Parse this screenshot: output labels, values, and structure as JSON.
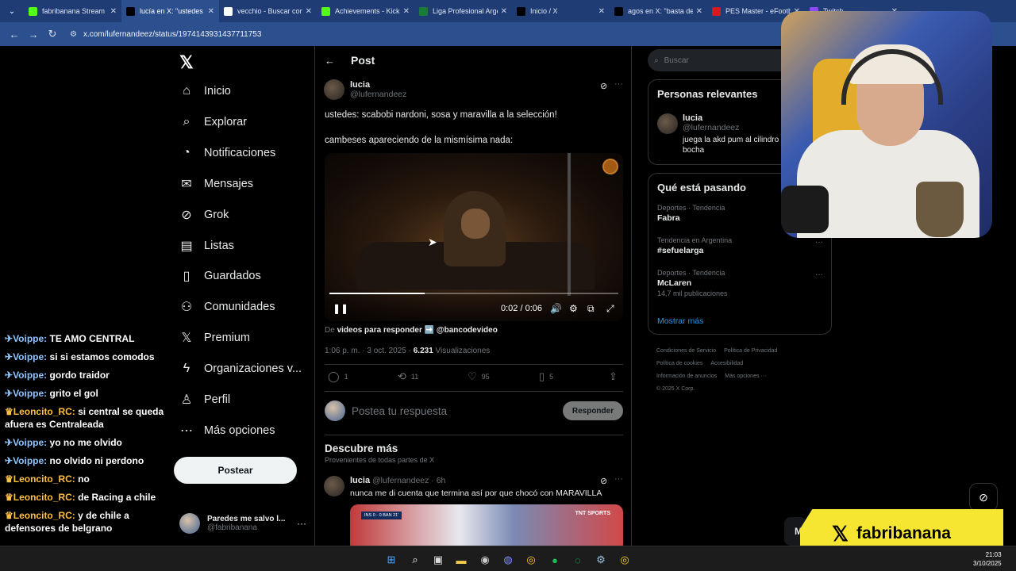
{
  "browser": {
    "tabs": [
      {
        "icon": "kick-favicon",
        "color": "#53fc18",
        "title": "fabribanana Stream",
        "active": false
      },
      {
        "icon": "x-favicon",
        "color": "#000000",
        "title": "lucía en X: \"ustedes",
        "active": true
      },
      {
        "icon": "google-favicon",
        "color": "#ffffff",
        "title": "vecchio - Buscar con",
        "active": false
      },
      {
        "icon": "kick-favicon",
        "color": "#53fc18",
        "title": "Achievements - Kick",
        "active": false
      },
      {
        "icon": "lpf-favicon",
        "color": "#1a7a3a",
        "title": "Liga Profesional Arge",
        "active": false
      },
      {
        "icon": "x-favicon",
        "color": "#000000",
        "title": "Inicio / X",
        "active": false
      },
      {
        "icon": "x-favicon",
        "color": "#000000",
        "title": "agos en X: \"basta de",
        "active": false
      },
      {
        "icon": "pes-favicon",
        "color": "#d41b24",
        "title": "PES Master - eFootba",
        "active": false
      },
      {
        "icon": "twitch-favicon",
        "color": "#9146ff",
        "title": "Twitch",
        "active": false
      }
    ],
    "url": "x.com/lufernandeez/status/1974143931437711753"
  },
  "nav": {
    "items": [
      {
        "icon": "home-icon",
        "glyph": "⌂",
        "label": "Inicio"
      },
      {
        "icon": "explore-icon",
        "glyph": "⌕",
        "label": "Explorar"
      },
      {
        "icon": "bell-icon",
        "glyph": "◔",
        "label": "Notificaciones"
      },
      {
        "icon": "mail-icon",
        "glyph": "✉",
        "label": "Mensajes"
      },
      {
        "icon": "grok-icon",
        "glyph": "⊘",
        "label": "Grok"
      },
      {
        "icon": "list-icon",
        "glyph": "▤",
        "label": "Listas"
      },
      {
        "icon": "bookmark-icon",
        "glyph": "▯",
        "label": "Guardados"
      },
      {
        "icon": "communities-icon",
        "glyph": "⚇",
        "label": "Comunidades"
      },
      {
        "icon": "x-premium-icon",
        "glyph": "𝕏",
        "label": "Premium"
      },
      {
        "icon": "bolt-icon",
        "glyph": "ϟ",
        "label": "Organizaciones v..."
      },
      {
        "icon": "person-icon",
        "glyph": "♙",
        "label": "Perfil"
      },
      {
        "icon": "more-circle-icon",
        "glyph": "⋯",
        "label": "Más opciones"
      }
    ],
    "post_button": "Postear",
    "account": {
      "name": "Paredes me salvo l...",
      "handle": "@fabribanana"
    }
  },
  "chat": [
    {
      "badge": "✈",
      "user": "Voippe:",
      "msg": "TE AMO CENTRAL",
      "vip": false
    },
    {
      "badge": "✈",
      "user": "Voippe:",
      "msg": "si si estamos comodos",
      "vip": false
    },
    {
      "badge": "✈",
      "user": "Voippe:",
      "msg": "gordo traidor",
      "vip": false
    },
    {
      "badge": "✈",
      "user": "Voippe:",
      "msg": "grito el gol",
      "vip": false
    },
    {
      "badge": "♛",
      "user": "Leoncito_RC:",
      "msg": "si central se queda afuera es Centraleada",
      "vip": true
    },
    {
      "badge": "✈",
      "user": "Voippe:",
      "msg": "yo no me olvido",
      "vip": false
    },
    {
      "badge": "✈",
      "user": "Voippe:",
      "msg": "no olvido ni perdono",
      "vip": false
    },
    {
      "badge": "♛",
      "user": "Leoncito_RC:",
      "msg": "no",
      "vip": true
    },
    {
      "badge": "♛",
      "user": "Leoncito_RC:",
      "msg": "de Racing a chile",
      "vip": true
    },
    {
      "badge": "♛",
      "user": "Leoncito_RC:",
      "msg": "y de chile a defensores de belgrano",
      "vip": true
    }
  ],
  "post": {
    "header": "Post",
    "author_name": "lucia",
    "author_handle": "@lufernandeez",
    "text1": "ustedes: scabobi nardoni, sosa y maravilla a la selección!",
    "text2": "cambeses apareciendo de la mismísima nada:",
    "video": {
      "time": "0:02 / 0:06",
      "progress": 0.33
    },
    "source_prefix": "De",
    "source_link": "videos para responder ➡️ @bancodevideo",
    "timestamp": "1:06 p. m. · 3 oct. 2025 ·",
    "views": "6.231",
    "views_label": "Visualizaciones",
    "stats": {
      "replies": "1",
      "reposts": "11",
      "likes": "95",
      "bookmarks": "5"
    },
    "reply_placeholder": "Postea tu respuesta",
    "reply_button": "Responder"
  },
  "discover": {
    "title": "Descubre más",
    "subtitle": "Provenientes de todas partes de X",
    "post": {
      "name": "lucia",
      "handle": "@lufernandeez · 6h",
      "text": "nunca me di cuenta que termina así por que chocó con MARAVILLA",
      "score": "INS 0 - 0 BAN 21'",
      "brand": "TNT SPORTS"
    }
  },
  "sidebar": {
    "search_placeholder": "Buscar",
    "relevant": {
      "title": "Personas relevantes",
      "name": "lucia",
      "handle": "@lufernandeez",
      "bio": "juega la akd pum al cilindro bocha"
    },
    "trends": {
      "title": "Qué está pasando",
      "items": [
        {
          "context": "Deportes · Tendencia",
          "name": "Fabra",
          "posts": ""
        },
        {
          "context": "Tendencia en Argentina",
          "name": "#sefuelarga",
          "posts": ""
        },
        {
          "context": "Deportes · Tendencia",
          "name": "McLaren",
          "posts": "14,7 mil publicaciones"
        }
      ],
      "show_more": "Mostrar más"
    },
    "footer": [
      "Condiciones de Servicio",
      "Política de Privacidad",
      "Política de cookies",
      "Accesibilidad",
      "Información de anuncios",
      "Más opciones ···",
      "© 2025 X Corp."
    ]
  },
  "overlay": {
    "logo_text": "fabribanana",
    "messages_peek": "M"
  },
  "taskbar": {
    "time": "21:03",
    "date": "3/10/2025"
  }
}
